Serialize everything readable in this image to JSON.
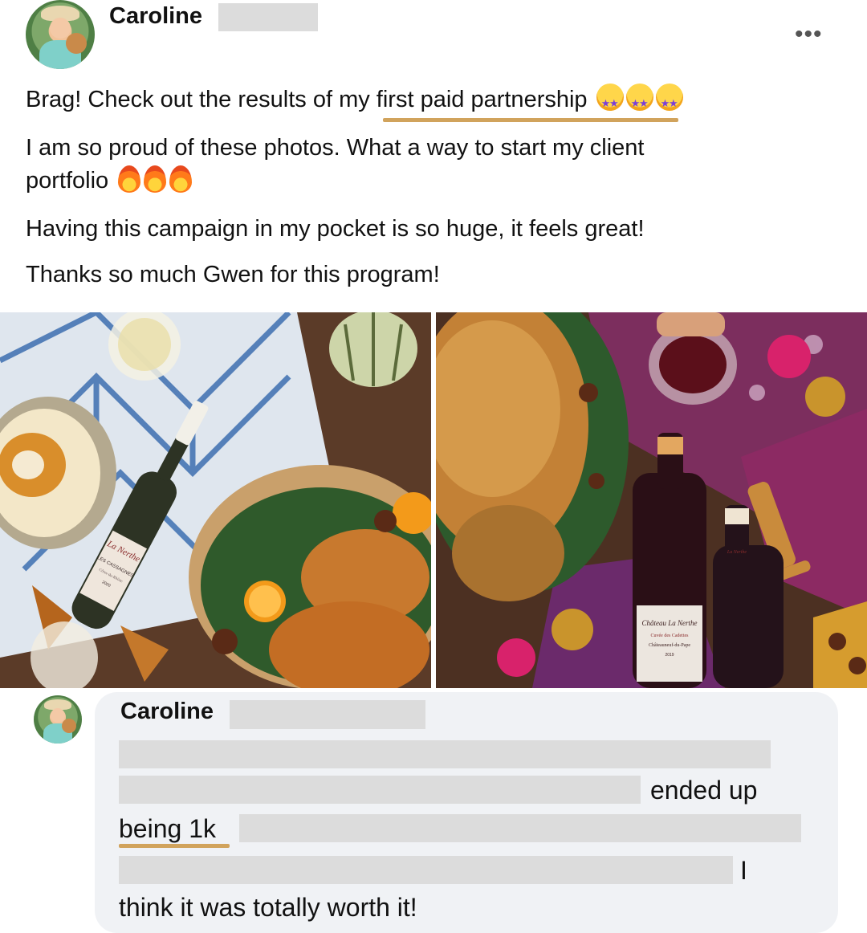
{
  "post": {
    "author_name": "Caroline",
    "more_label": "•••",
    "line1_pre": "Brag! Check out the results of ",
    "line1_highlight": "my first paid partnership",
    "line2": "I am so proud of these photos. What a way to start my client",
    "line3": "portfolio",
    "line4": "Having this campaign in my pocket is so huge, it feels great!",
    "line5": "Thanks so much Gwen for this program!",
    "photo_left": {
      "label_brand": "La Nerthe",
      "label_name": "LES CASSAGNES",
      "label_region": "Côtes-du-Rhône",
      "label_year": "2020"
    },
    "photo_right": {
      "label_brand": "Château La Nerthe",
      "label_name": "Cuvée des Cadettes",
      "label_region": "Châteauneuf-du-Pape",
      "label_year": "2019",
      "small_label": "La Nerthe"
    }
  },
  "comment": {
    "author_name": "Caroline",
    "text_a": "ended up",
    "text_b": "being 1k",
    "text_c": "I",
    "text_d": "think it was totally worth it!"
  },
  "colors": {
    "underline": "#d1a35c",
    "bubble": "#f0f2f5",
    "redaction": "#dcdcdc"
  }
}
